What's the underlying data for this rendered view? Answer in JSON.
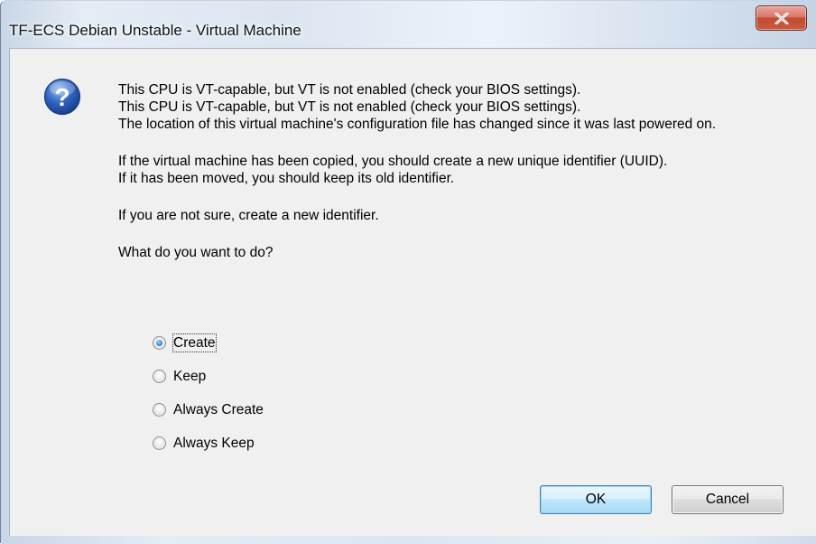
{
  "window": {
    "title": "TF-ECS Debian Unstable - Virtual Machine"
  },
  "icons": {
    "dialog_icon": "question-icon",
    "close_icon": "close-icon"
  },
  "message": {
    "lines": [
      "This CPU is VT-capable, but VT is not enabled (check your BIOS settings).",
      "This CPU is VT-capable, but VT is not enabled (check your BIOS settings).",
      "The location of this virtual machine's configuration file has changed since it was last powered on."
    ],
    "uuid_paragraph": [
      "If the virtual machine has been copied, you should create a new unique identifier (UUID).",
      "If it has been moved, you should keep its old identifier."
    ],
    "unsure": "If you are not sure, create a new identifier.",
    "question": "What do you want to do?"
  },
  "options": [
    {
      "label": "Create",
      "checked": true
    },
    {
      "label": "Keep",
      "checked": false
    },
    {
      "label": "Always Create",
      "checked": false
    },
    {
      "label": "Always Keep",
      "checked": false
    }
  ],
  "buttons": {
    "ok": "OK",
    "cancel": "Cancel"
  },
  "colors": {
    "accent_blue": "#3a8fd8",
    "close_red": "#c44a33",
    "dialog_bg": "#f0f0f0"
  }
}
